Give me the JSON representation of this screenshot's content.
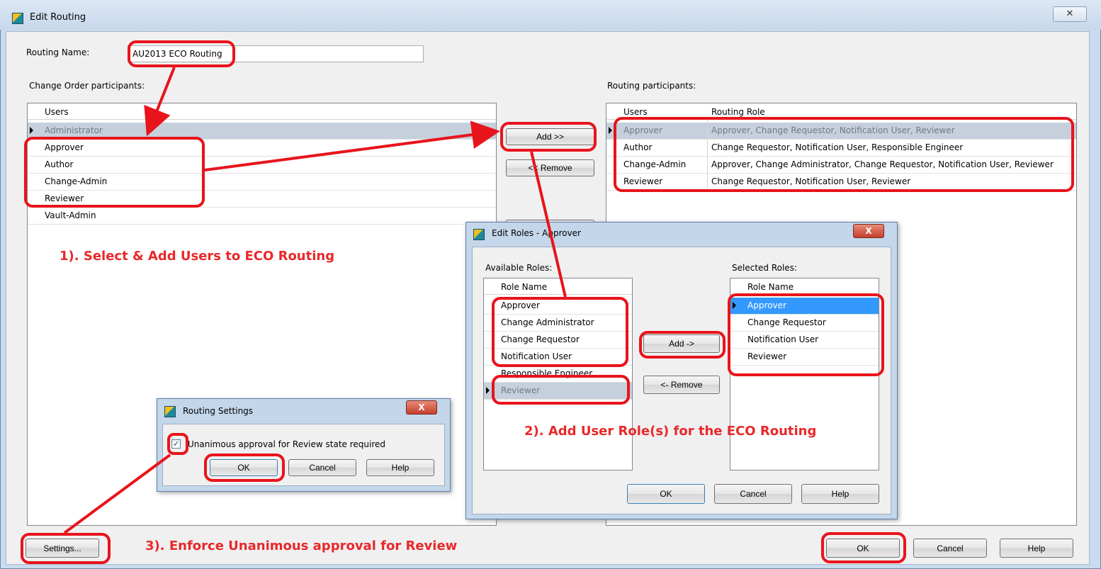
{
  "window": {
    "title": "Edit Routing",
    "close_symbol": "✕",
    "routing_name_label": "Routing Name:",
    "routing_name_value": "AU2013 ECO Routing",
    "change_order_participants_label": "Change Order participants:",
    "routing_participants_label": "Routing participants:"
  },
  "change_order_grid": {
    "header": "Users",
    "rows": [
      "Administrator",
      "Approver",
      "Author",
      "Change-Admin",
      "Reviewer",
      "Vault-Admin"
    ]
  },
  "middle_buttons": {
    "add": "Add >>",
    "remove": "<< Remove"
  },
  "routing_grid": {
    "headers": [
      "Users",
      "Routing Role"
    ],
    "rows": [
      {
        "user": "Approver",
        "role": "Approver, Change Requestor, Notification User, Reviewer"
      },
      {
        "user": "Author",
        "role": "Change Requestor, Notification User, Responsible Engineer"
      },
      {
        "user": "Change-Admin",
        "role": "Approver, Change Administrator, Change Requestor, Notification User, Reviewer"
      },
      {
        "user": "Reviewer",
        "role": "Change Requestor, Notification User, Reviewer"
      }
    ]
  },
  "bottom_buttons": {
    "settings": "Settings...",
    "ok": "OK",
    "cancel": "Cancel",
    "help": "Help"
  },
  "edit_roles_dialog": {
    "title": "Edit Roles - Approver",
    "close_symbol": "X",
    "available_label": "Available Roles:",
    "selected_label": "Selected Roles:",
    "header": "Role Name",
    "available_roles": [
      "Approver",
      "Change Administrator",
      "Change Requestor",
      "Notification User",
      "Responsible Engineer",
      "Reviewer"
    ],
    "selected_roles": [
      "Approver",
      "Change Requestor",
      "Notification User",
      "Reviewer"
    ],
    "add": "Add ->",
    "remove": "<- Remove",
    "ok": "OK",
    "cancel": "Cancel",
    "help": "Help"
  },
  "routing_settings_dialog": {
    "title": "Routing Settings",
    "close_symbol": "X",
    "checkbox_mark": "✓",
    "checkbox_label": "Unanimous approval for Review state required",
    "checkbox_checked": true,
    "ok": "OK",
    "cancel": "Cancel",
    "help": "Help"
  },
  "annotations": {
    "step1": "1). Select & Add Users to ECO Routing",
    "step2": "2). Add User Role(s) for the ECO Routing",
    "step3": "3). Enforce Unanimous approval for Review",
    "color": "#e8141c"
  }
}
